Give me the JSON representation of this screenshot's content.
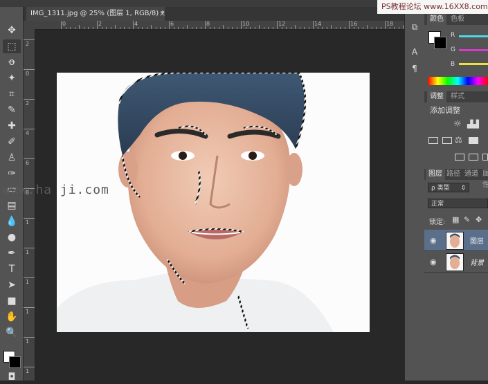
{
  "watermark_top": "PS教程论坛 www.16XX8.com",
  "watermark_mid": "www.ha          ji.com",
  "document": {
    "tab_title": "IMG_1311.jpg @ 25% (图层 1, RGB/8)",
    "modified_mark": "*",
    "close_glyph": "×"
  },
  "ruler": {
    "h_labels": [
      "0",
      "2",
      "4",
      "6",
      "8",
      "10",
      "12",
      "14",
      "16",
      "18"
    ],
    "v_labels": [
      "2",
      "0",
      "2",
      "4",
      "6",
      "8",
      "1",
      "1",
      "1",
      "1",
      "1",
      "1"
    ]
  },
  "tools": [
    {
      "icon": "move-icon",
      "glyph": "✥"
    },
    {
      "icon": "marquee-icon",
      "glyph": "⬚"
    },
    {
      "icon": "lasso-icon",
      "glyph": "ꝋ"
    },
    {
      "icon": "magic-wand-icon",
      "glyph": "✦"
    },
    {
      "icon": "crop-icon",
      "glyph": "⌗"
    },
    {
      "icon": "eyedropper-icon",
      "glyph": "✎"
    },
    {
      "icon": "healing-brush-icon",
      "glyph": "✚"
    },
    {
      "icon": "brush-icon",
      "glyph": "✐"
    },
    {
      "icon": "clone-stamp-icon",
      "glyph": "♙"
    },
    {
      "icon": "history-brush-icon",
      "glyph": "✑"
    },
    {
      "icon": "eraser-icon",
      "glyph": "▭"
    },
    {
      "icon": "gradient-icon",
      "glyph": "▤"
    },
    {
      "icon": "blur-icon",
      "glyph": "💧"
    },
    {
      "icon": "dodge-icon",
      "glyph": "●"
    },
    {
      "icon": "pen-icon",
      "glyph": "✒"
    },
    {
      "icon": "type-icon",
      "glyph": "T"
    },
    {
      "icon": "path-selection-icon",
      "glyph": "➤"
    },
    {
      "icon": "rectangle-shape-icon",
      "glyph": "■"
    },
    {
      "icon": "hand-icon",
      "glyph": "✋"
    },
    {
      "icon": "zoom-icon",
      "glyph": "🔍"
    }
  ],
  "right_strip": [
    {
      "icon": "history-icon",
      "glyph": "⧉"
    },
    {
      "icon": "character-icon",
      "glyph": "A"
    },
    {
      "icon": "paragraph-icon",
      "glyph": "¶"
    }
  ],
  "color_panel": {
    "tabs": [
      "颜色",
      "色板"
    ],
    "channels": [
      {
        "letter": "R",
        "color": "#4fd7e6"
      },
      {
        "letter": "G",
        "color": "#d63cc8"
      },
      {
        "letter": "B",
        "color": "#e7e23c"
      }
    ],
    "foreground": "#ffffff",
    "background": "#000000"
  },
  "adjustments_panel": {
    "tabs": [
      "调整",
      "样式"
    ],
    "title": "添加调整"
  },
  "layers_panel": {
    "tabs": [
      "图层",
      "路径",
      "通道",
      "属性"
    ],
    "filter_label": "ρ 类型",
    "blend_mode": "正常",
    "lock_label": "锁定:",
    "layers": [
      {
        "name": "图层",
        "selected": true
      },
      {
        "name": "背景",
        "selected": false
      }
    ]
  }
}
